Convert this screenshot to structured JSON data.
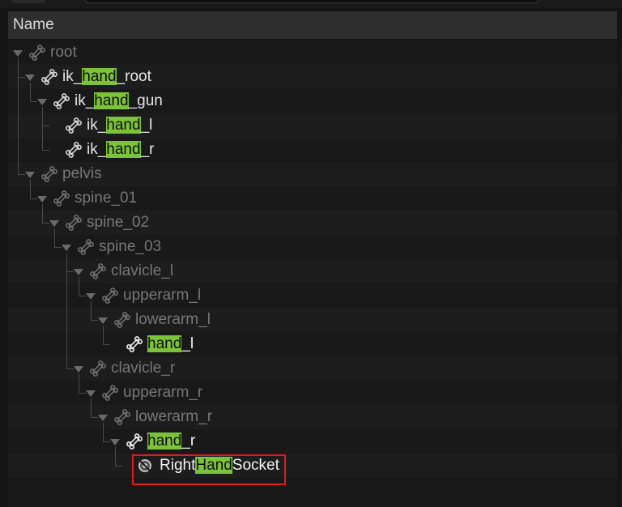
{
  "header": {
    "name_column": "Name"
  },
  "tree": {
    "highlight_term": "hand",
    "rows": [
      {
        "parts": [
          "root"
        ],
        "style": "dim"
      },
      {
        "parts": [
          "ik_",
          "hand",
          "_root"
        ],
        "style": "bright"
      },
      {
        "parts": [
          "ik_",
          "hand",
          "_gun"
        ],
        "style": "bright"
      },
      {
        "parts": [
          "ik_",
          "hand",
          "_l"
        ],
        "style": "bright"
      },
      {
        "parts": [
          "ik_",
          "hand",
          "_r"
        ],
        "style": "bright"
      },
      {
        "parts": [
          "pelvis"
        ],
        "style": "dim"
      },
      {
        "parts": [
          "spine_01"
        ],
        "style": "dim"
      },
      {
        "parts": [
          "spine_02"
        ],
        "style": "dim"
      },
      {
        "parts": [
          "spine_03"
        ],
        "style": "dim"
      },
      {
        "parts": [
          "clavicle_l"
        ],
        "style": "dim"
      },
      {
        "parts": [
          "upperarm_l"
        ],
        "style": "dim"
      },
      {
        "parts": [
          "lowerarm_l"
        ],
        "style": "dim"
      },
      {
        "parts": [
          "",
          "hand",
          "_l"
        ],
        "style": "white"
      },
      {
        "parts": [
          "clavicle_r"
        ],
        "style": "dim"
      },
      {
        "parts": [
          "upperarm_r"
        ],
        "style": "dim"
      },
      {
        "parts": [
          "lowerarm_r"
        ],
        "style": "dim"
      },
      {
        "parts": [
          "",
          "hand",
          "_r"
        ],
        "style": "white"
      },
      {
        "parts": [
          "Right",
          "Hand",
          "Socket"
        ],
        "style": "white",
        "icon": "socket-icon",
        "selected": true
      }
    ]
  },
  "colors": {
    "highlight": "#7cc23a",
    "selection_outline": "#e01b1b"
  }
}
